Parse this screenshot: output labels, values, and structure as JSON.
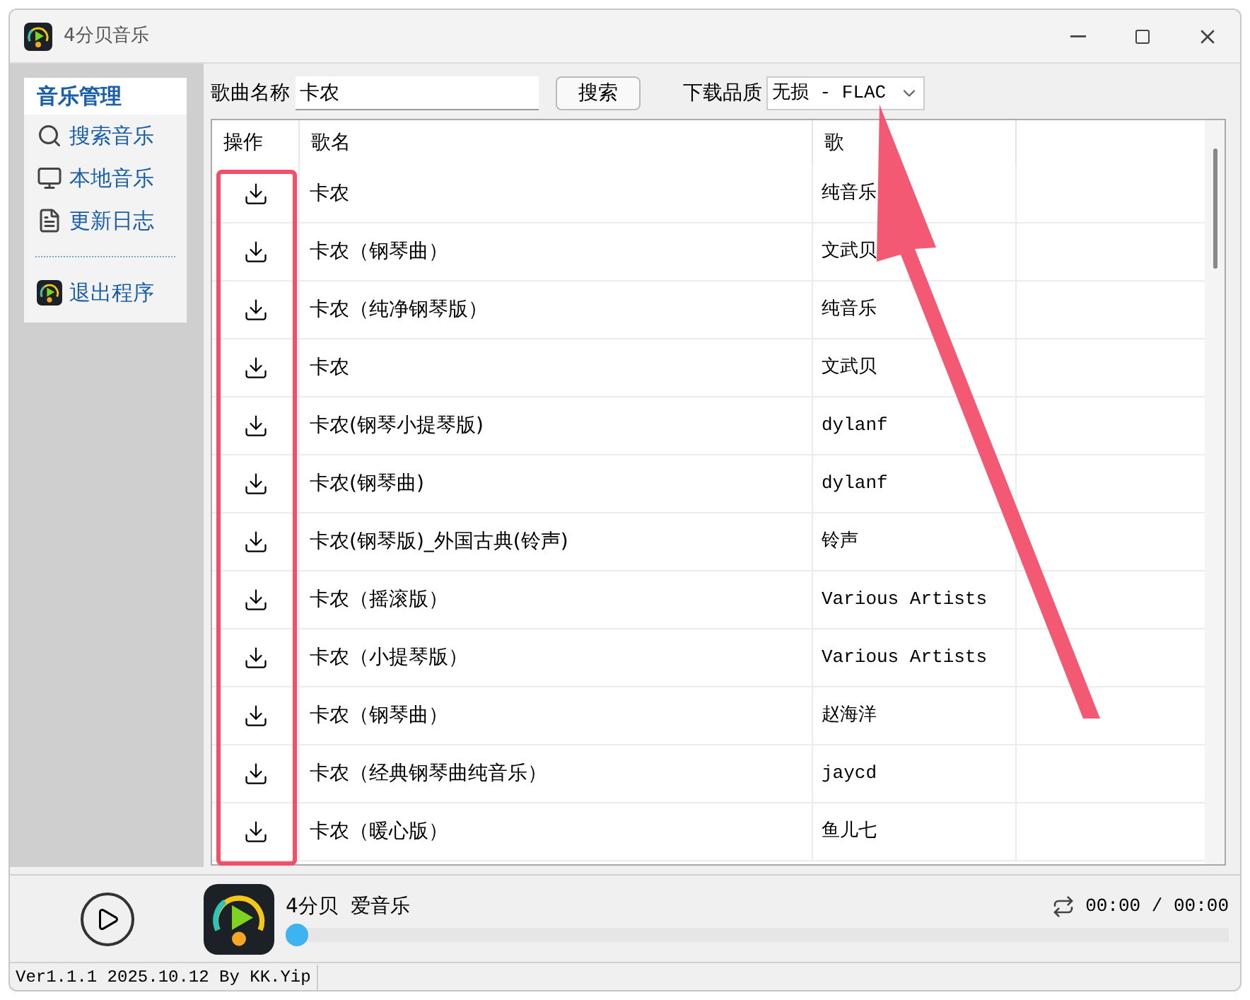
{
  "window": {
    "title": "4分贝音乐"
  },
  "sidebar": {
    "title": "音乐管理",
    "items": [
      {
        "label": "搜索音乐",
        "kind": "search"
      },
      {
        "label": "本地音乐",
        "kind": "monitor"
      },
      {
        "label": "更新日志",
        "kind": "log"
      }
    ],
    "exit": {
      "label": "退出程序"
    }
  },
  "search": {
    "label": "歌曲名称",
    "value": "卡农",
    "button": "搜索",
    "quality_label": "下载品质",
    "quality": "无损 - FLAC"
  },
  "table": {
    "columns": [
      "操作",
      "歌名",
      "歌"
    ],
    "rows": [
      {
        "title": "卡农",
        "artist": "纯音乐"
      },
      {
        "title": "卡农（钢琴曲）",
        "artist": "文武贝"
      },
      {
        "title": "卡农（纯净钢琴版）",
        "artist": "纯音乐"
      },
      {
        "title": "卡农",
        "artist": "文武贝"
      },
      {
        "title": "卡农(钢琴小提琴版)",
        "artist": "dylanf"
      },
      {
        "title": "卡农(钢琴曲)",
        "artist": "dylanf"
      },
      {
        "title": "卡农(钢琴版)_外国古典(铃声)",
        "artist": "铃声"
      },
      {
        "title": "卡农（摇滚版）",
        "artist": "Various Artists"
      },
      {
        "title": "卡农（小提琴版）",
        "artist": "Various Artists"
      },
      {
        "title": "卡农（钢琴曲）",
        "artist": "赵海洋"
      },
      {
        "title": "卡农（经典钢琴曲纯音乐）",
        "artist": "jaycd"
      },
      {
        "title": "卡农（暖心版）",
        "artist": "鱼儿七"
      }
    ]
  },
  "player": {
    "title": "4分贝  爱音乐",
    "time": "00:00 / 00:00",
    "level": 0
  },
  "status_bar": "Ver1.1.1 2025.10.12 By KK.Yip"
}
